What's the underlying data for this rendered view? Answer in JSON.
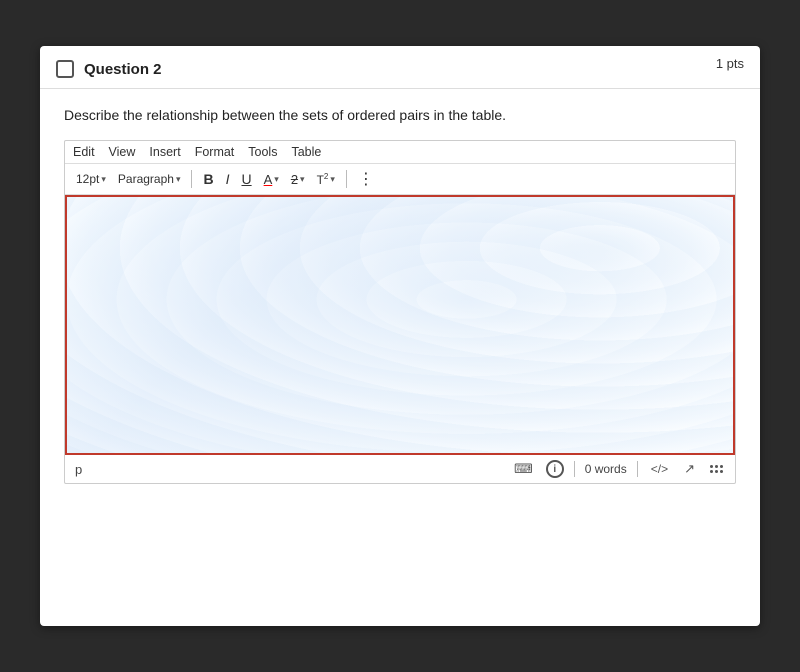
{
  "card": {
    "pts": "1 pts",
    "question_number": "Question 2",
    "question_text": "Describe the relationship between the sets of ordered pairs in the table."
  },
  "menubar": {
    "items": [
      "Edit",
      "View",
      "Insert",
      "Format",
      "Tools",
      "Table"
    ]
  },
  "toolbar": {
    "font_size": "12pt",
    "paragraph": "Paragraph"
  },
  "statusbar": {
    "p_label": "p",
    "word_count_label": "0 words",
    "code_label": "</>",
    "expand_label": "↗",
    "dots_label": "⋮⋮"
  }
}
